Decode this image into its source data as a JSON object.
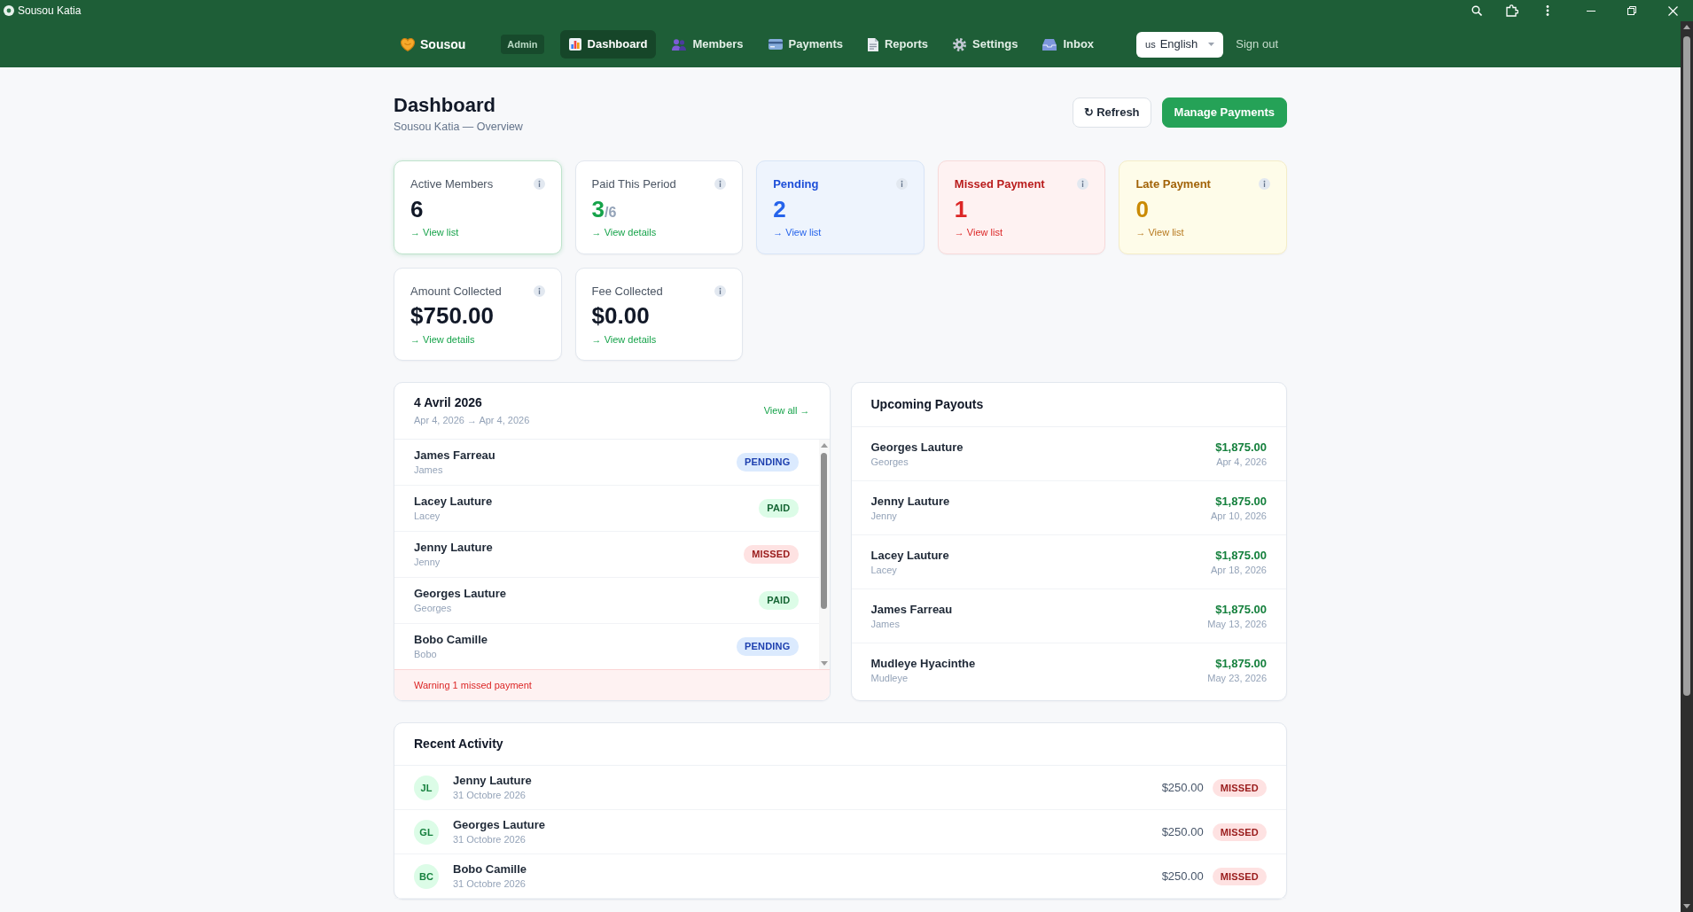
{
  "window": {
    "title": "Sousou Katia"
  },
  "navbar": {
    "brand": "Sousou",
    "role_badge": "Admin",
    "items": [
      {
        "label": "Dashboard",
        "selected": true
      },
      {
        "label": "Members",
        "selected": false
      },
      {
        "label": "Payments",
        "selected": false
      },
      {
        "label": "Reports",
        "selected": false
      },
      {
        "label": "Settings",
        "selected": false
      },
      {
        "label": "Inbox",
        "selected": false
      }
    ],
    "language": {
      "flag": "us",
      "label": "English"
    },
    "sign_out": "Sign out"
  },
  "page_header": {
    "title": "Dashboard",
    "subtitle": "Sousou Katia — Overview",
    "buttons": [
      {
        "label": "↻ Refresh",
        "kind": "outline"
      },
      {
        "label": "Manage Payments",
        "kind": "primary"
      }
    ]
  },
  "stats": [
    {
      "label": "Active Members",
      "value": "6",
      "link": "→ View list",
      "kind": "plain",
      "selected": true
    },
    {
      "label": "Paid This Period",
      "value": "3",
      "suffix": "/6",
      "link": "→ View details",
      "kind": "paid",
      "selected": false
    },
    {
      "label": "Pending",
      "value": "2",
      "link": "→ View list",
      "kind": "pending",
      "selected": false
    },
    {
      "label": "Missed Payment",
      "value": "1",
      "link": "→ View list",
      "kind": "missed",
      "selected": false
    },
    {
      "label": "Late Payment",
      "value": "0",
      "link": "→ View list",
      "kind": "late",
      "selected": false
    },
    {
      "label": "Amount Collected",
      "value": "$750.00",
      "link": "→ View details",
      "kind": "plain",
      "selected": false
    },
    {
      "label": "Fee Collected",
      "value": "$0.00",
      "link": "→ View details",
      "kind": "plain",
      "selected": false
    }
  ],
  "period": {
    "title": "4 Avril 2026",
    "range": "Apr 4, 2026 → Apr 4, 2026",
    "link": "View all →",
    "members": [
      {
        "name": "James Farreau",
        "nickname": "James",
        "status": "PENDING",
        "kind": "pending"
      },
      {
        "name": "Lacey Lauture",
        "nickname": "Lacey",
        "status": "PAID",
        "kind": "paid"
      },
      {
        "name": "Jenny Lauture",
        "nickname": "Jenny",
        "status": "MISSED",
        "kind": "missed"
      },
      {
        "name": "Georges Lauture",
        "nickname": "Georges",
        "status": "PAID",
        "kind": "paid"
      },
      {
        "name": "Bobo Camille",
        "nickname": "Bobo",
        "status": "PENDING",
        "kind": "pending"
      }
    ],
    "warning": "Warning 1 missed payment"
  },
  "payouts": {
    "title": "Upcoming Payouts",
    "rows": [
      {
        "name": "Georges Lauture",
        "nickname": "Georges",
        "amount": "$1,875.00",
        "date": "Apr 4, 2026"
      },
      {
        "name": "Jenny Lauture",
        "nickname": "Jenny",
        "amount": "$1,875.00",
        "date": "Apr 10, 2026"
      },
      {
        "name": "Lacey Lauture",
        "nickname": "Lacey",
        "amount": "$1,875.00",
        "date": "Apr 18, 2026"
      },
      {
        "name": "James Farreau",
        "nickname": "James",
        "amount": "$1,875.00",
        "date": "May 13, 2026"
      },
      {
        "name": "Mudleye Hyacinthe",
        "nickname": "Mudleye",
        "amount": "$1,875.00",
        "date": "May 23, 2026"
      }
    ]
  },
  "activity": {
    "title": "Recent Activity",
    "rows": [
      {
        "initials": "JL",
        "name": "Jenny Lauture",
        "date": "31 Octobre 2026",
        "amount": "$250.00",
        "status": "MISSED",
        "kind": "missed"
      },
      {
        "initials": "GL",
        "name": "Georges Lauture",
        "date": "31 Octobre 2026",
        "amount": "$250.00",
        "status": "MISSED",
        "kind": "missed"
      },
      {
        "initials": "BC",
        "name": "Bobo Camille",
        "date": "31 Octobre 2026",
        "amount": "$250.00",
        "status": "MISSED",
        "kind": "missed"
      }
    ]
  }
}
